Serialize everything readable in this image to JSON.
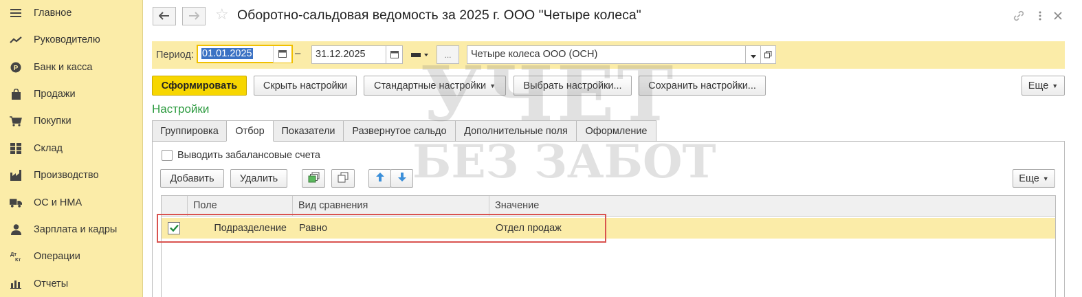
{
  "sidebar": {
    "items": [
      {
        "label": "Главное",
        "icon": "menu-lines-icon"
      },
      {
        "label": "Руководителю",
        "icon": "trend-chart-icon"
      },
      {
        "label": "Банк и касса",
        "icon": "coin-icon"
      },
      {
        "label": "Продажи",
        "icon": "shopping-bag-icon"
      },
      {
        "label": "Покупки",
        "icon": "cart-icon"
      },
      {
        "label": "Склад",
        "icon": "warehouse-grid-icon"
      },
      {
        "label": "Производство",
        "icon": "factory-icon"
      },
      {
        "label": "ОС и НМА",
        "icon": "truck-icon"
      },
      {
        "label": "Зарплата и кадры",
        "icon": "person-icon"
      },
      {
        "label": "Операции",
        "icon": "dt-kt-icon"
      },
      {
        "label": "Отчеты",
        "icon": "bar-chart-icon"
      }
    ]
  },
  "header": {
    "title": "Оборотно-сальдовая ведомость за 2025 г. ООО \"Четыре колеса\""
  },
  "period": {
    "label": "Период:",
    "from": "01.01.2025",
    "dash": "–",
    "to": "31.12.2025",
    "ellipsis": "...",
    "organization": "Четыре колеса ООО (ОСН)"
  },
  "toolbar": {
    "generate": "Сформировать",
    "hide_settings": "Скрыть настройки",
    "standard_settings": "Стандартные настройки",
    "choose_settings": "Выбрать настройки...",
    "save_settings": "Сохранить настройки...",
    "more": "Еще"
  },
  "settings": {
    "title": "Настройки",
    "tabs": [
      "Группировка",
      "Отбор",
      "Показатели",
      "Развернутое сальдо",
      "Дополнительные поля",
      "Оформление"
    ],
    "active_tab": 1
  },
  "filter": {
    "offbalance_label": "Выводить забалансовые счета",
    "add": "Добавить",
    "delete": "Удалить",
    "more": "Еще",
    "columns": [
      "Поле",
      "Вид сравнения",
      "Значение"
    ],
    "rows": [
      {
        "checked": true,
        "field": "Подразделение",
        "comparison": "Равно",
        "value": "Отдел продаж"
      }
    ]
  },
  "watermark": {
    "line1": "УЧЕТ",
    "line2": "БЕЗ ЗАБОТ"
  },
  "colors": {
    "sidebar_bg": "#fbeca8",
    "primary_button": "#f7d600",
    "section_title": "#2b9a3e",
    "highlight": "#d9534f"
  }
}
